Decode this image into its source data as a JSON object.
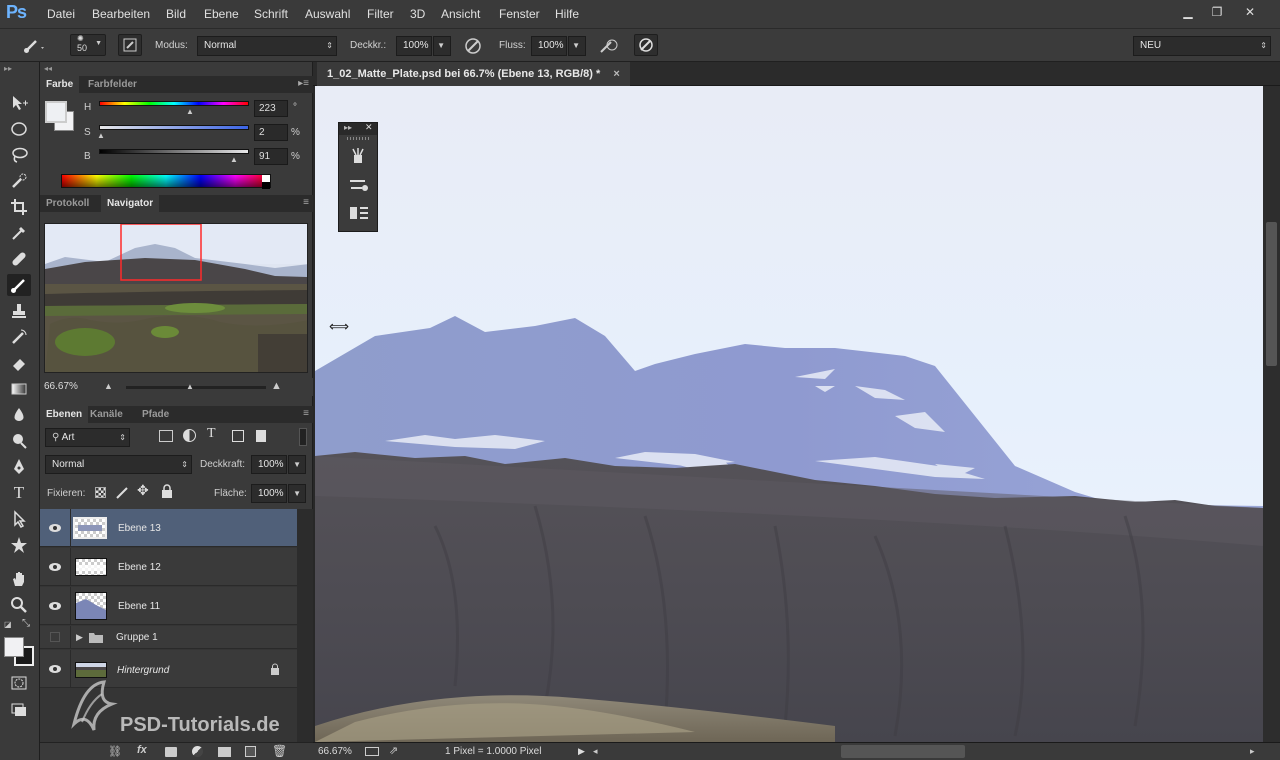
{
  "app": {
    "logo": "Ps"
  },
  "menu": [
    "Datei",
    "Bearbeiten",
    "Bild",
    "Ebene",
    "Schrift",
    "Auswahl",
    "Filter",
    "3D",
    "Ansicht",
    "Fenster",
    "Hilfe"
  ],
  "window_controls": {
    "minimize": "▁",
    "restore": "❐",
    "close": "✕"
  },
  "options": {
    "brush_size": "50",
    "modus_label": "Modus:",
    "modus_value": "Normal",
    "deckkr_label": "Deckkr.:",
    "deckkr_value": "100%",
    "fluss_label": "Fluss:",
    "fluss_value": "100%",
    "workspace_value": "NEU"
  },
  "color_panel": {
    "tabs": [
      "Farbe",
      "Farbfelder"
    ],
    "h_label": "H",
    "h_value": "223",
    "h_unit": "°",
    "s_label": "S",
    "s_value": "2",
    "s_unit": "%",
    "b_label": "B",
    "b_value": "91",
    "b_unit": "%"
  },
  "navigator_panel": {
    "tabs": [
      "Protokoll",
      "Navigator"
    ],
    "zoom": "66.67%"
  },
  "layers_panel": {
    "tabs": [
      "Ebenen",
      "Kanäle",
      "Pfade"
    ],
    "filter_value": "Art",
    "blend_value": "Normal",
    "opacity_label": "Deckkraft:",
    "opacity_value": "100%",
    "lock_label": "Fixieren:",
    "fill_label": "Fläche:",
    "fill_value": "100%",
    "layers": [
      {
        "name": "Ebene 13",
        "visible": true,
        "selected": true
      },
      {
        "name": "Ebene 12",
        "visible": true,
        "selected": false
      },
      {
        "name": "Ebene 11",
        "visible": true,
        "selected": false
      },
      {
        "name": "Gruppe 1",
        "visible": false,
        "selected": false
      },
      {
        "name": "Hintergrund",
        "visible": true,
        "selected": false
      }
    ]
  },
  "document": {
    "tab_title": "1_02_Matte_Plate.psd bei 66.7% (Ebene 13, RGB/8) *",
    "close": "×",
    "status_zoom": "66.67%",
    "status_info": "1 Pixel = 1.0000 Pixel"
  },
  "watermark": "PSD-Tutorials.de"
}
